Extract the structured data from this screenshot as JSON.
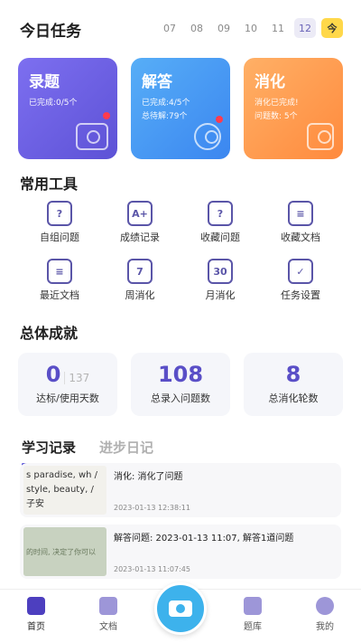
{
  "header": {
    "title": "今日任务",
    "dates": [
      "07",
      "08",
      "09",
      "10",
      "11",
      "12"
    ],
    "selected_date": "12",
    "today_label": "今"
  },
  "cards": [
    {
      "title": "录题",
      "lines": [
        "已完成:0/5个"
      ],
      "icon": "camera-icon",
      "color": "#6a5ee6",
      "has_dot": true
    },
    {
      "title": "解答",
      "lines": [
        "已完成:4/5个",
        "总待解:79个"
      ],
      "icon": "lightbulb-icon",
      "color": "#4a9af3",
      "has_dot": true
    },
    {
      "title": "消化",
      "lines": [
        "消化已完成!",
        "问题数: 5个"
      ],
      "icon": "check-box-icon",
      "color": "#ff9a4a",
      "has_dot": false
    }
  ],
  "tools_section": {
    "title": "常用工具",
    "items": [
      {
        "label": "自组问题",
        "icon": "question-doc-icon",
        "glyph": "?"
      },
      {
        "label": "成绩记录",
        "icon": "grade-record-icon",
        "glyph": "A+"
      },
      {
        "label": "收藏问题",
        "icon": "star-question-icon",
        "glyph": "?"
      },
      {
        "label": "收藏文档",
        "icon": "star-document-icon",
        "glyph": "≡"
      },
      {
        "label": "最近文档",
        "icon": "recent-document-icon",
        "glyph": "≡"
      },
      {
        "label": "周消化",
        "icon": "calendar-7-icon",
        "glyph": "7"
      },
      {
        "label": "月消化",
        "icon": "calendar-30-icon",
        "glyph": "30"
      },
      {
        "label": "任务设置",
        "icon": "task-settings-icon",
        "glyph": "✓"
      }
    ]
  },
  "achievements": {
    "title": "总体成就",
    "stats": [
      {
        "value": "0",
        "sub": "137",
        "label": "达标/使用天数"
      },
      {
        "value": "108",
        "label": "总录入问题数"
      },
      {
        "value": "8",
        "label": "总消化轮数"
      }
    ]
  },
  "tabs": [
    {
      "label": "学习记录",
      "active": true
    },
    {
      "label": "进步日记",
      "active": false
    }
  ],
  "records": [
    {
      "thumb_text": "s paradise, wh / style, beauty, / 子安",
      "text": "消化: 消化了问题",
      "time": "2023-01-13 12:38:11"
    },
    {
      "thumb_text": "的时间, 决定了你可以",
      "text": "解答问题: 2023-01-13 11:07, 解答1道问题",
      "time": "2023-01-13 11:07:45"
    }
  ],
  "nav": {
    "items": [
      {
        "label": "首页",
        "icon": "home-icon",
        "active": true
      },
      {
        "label": "文档",
        "icon": "document-icon",
        "active": false
      },
      {
        "label": "题库",
        "icon": "question-bank-icon",
        "active": false
      },
      {
        "label": "我的",
        "icon": "profile-icon",
        "active": false
      }
    ],
    "center_icon": "camera-capture-icon"
  }
}
